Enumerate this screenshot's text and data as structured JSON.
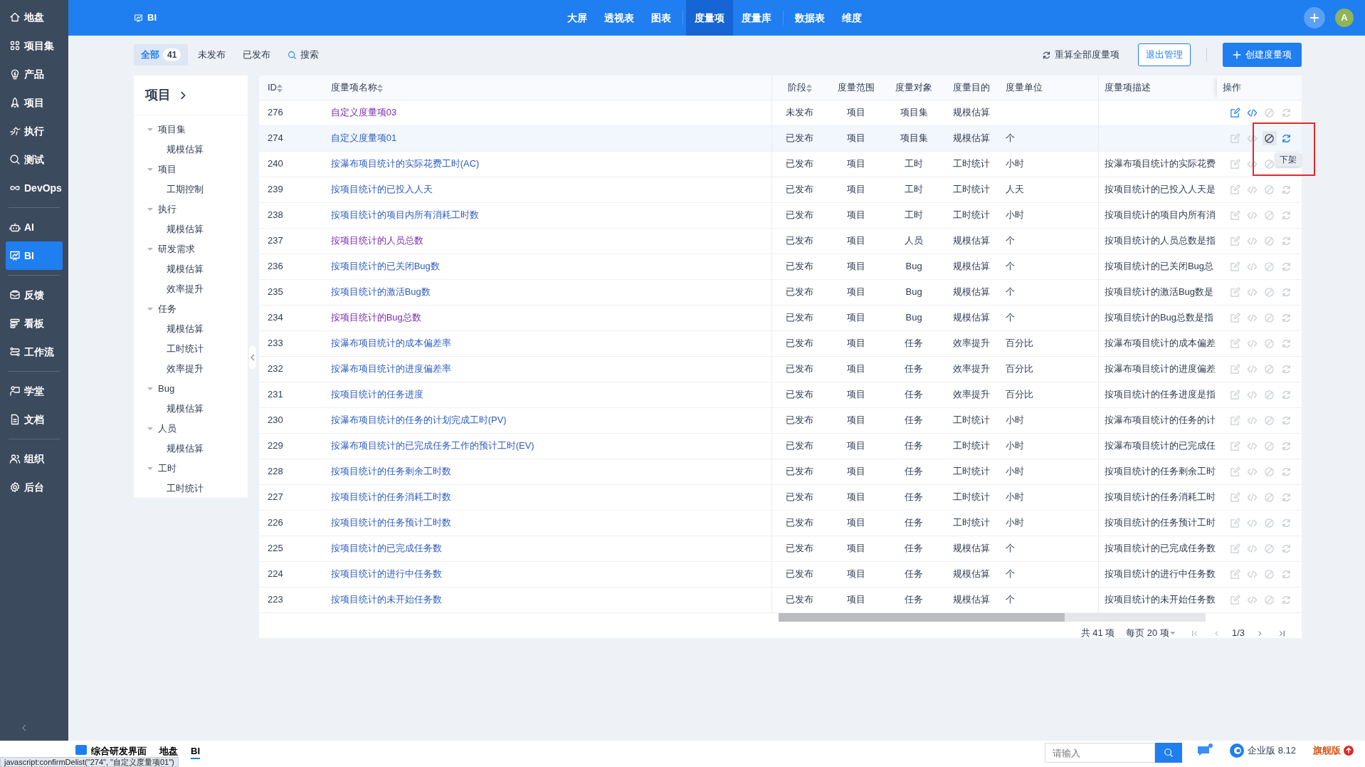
{
  "sidebar": {
    "items": [
      {
        "label": "地盘",
        "selected": false
      },
      {
        "label": "项目集",
        "selected": false
      },
      {
        "label": "产品",
        "selected": false
      },
      {
        "label": "项目",
        "selected": false
      },
      {
        "label": "执行",
        "selected": false
      },
      {
        "label": "测试",
        "selected": false
      },
      {
        "label": "DevOps",
        "selected": false
      },
      {
        "label": "AI",
        "selected": false
      },
      {
        "label": "BI",
        "selected": true
      },
      {
        "label": "反馈",
        "selected": false
      },
      {
        "label": "看板",
        "selected": false
      },
      {
        "label": "工作流",
        "selected": false
      },
      {
        "label": "学堂",
        "selected": false
      },
      {
        "label": "文档",
        "selected": false
      },
      {
        "label": "组织",
        "selected": false
      },
      {
        "label": "后台",
        "selected": false
      }
    ]
  },
  "header": {
    "app": "BI",
    "tabs": [
      {
        "label": "大屏",
        "selected": false
      },
      {
        "label": "透视表",
        "selected": false
      },
      {
        "label": "图表",
        "selected": false
      },
      {
        "label": "度量项",
        "selected": true
      },
      {
        "label": "度量库",
        "selected": false
      },
      {
        "label": "数据表",
        "selected": false
      },
      {
        "label": "维度",
        "selected": false
      }
    ],
    "avatar": "A"
  },
  "toolbar": {
    "filters": [
      {
        "label": "全部",
        "count": "41",
        "selected": true
      },
      {
        "label": "未发布",
        "selected": false
      },
      {
        "label": "已发布",
        "selected": false
      }
    ],
    "search": "搜索",
    "recalc": "重算全部度量项",
    "exit": "退出管理",
    "create": "创建度量项"
  },
  "tree": {
    "title": "项目",
    "items": [
      {
        "label": "项目集",
        "expanded": true,
        "children": [
          {
            "label": "规模估算"
          }
        ]
      },
      {
        "label": "项目",
        "expanded": true,
        "children": [
          {
            "label": "工期控制"
          }
        ]
      },
      {
        "label": "执行",
        "expanded": true,
        "children": [
          {
            "label": "规模估算"
          }
        ]
      },
      {
        "label": "研发需求",
        "expanded": true,
        "children": [
          {
            "label": "规模估算"
          },
          {
            "label": "效率提升"
          }
        ]
      },
      {
        "label": "任务",
        "expanded": true,
        "children": [
          {
            "label": "规模估算"
          },
          {
            "label": "工时统计"
          },
          {
            "label": "效率提升"
          }
        ]
      },
      {
        "label": "Bug",
        "expanded": true,
        "children": [
          {
            "label": "规模估算"
          }
        ]
      },
      {
        "label": "人员",
        "expanded": true,
        "children": [
          {
            "label": "规模估算"
          }
        ]
      },
      {
        "label": "工时",
        "expanded": true,
        "children": [
          {
            "label": "工时统计"
          }
        ]
      }
    ]
  },
  "table": {
    "columns": [
      "ID",
      "度量项名称",
      "阶段",
      "度量范围",
      "度量对象",
      "度量目的",
      "度量单位",
      "度量项描述",
      "操作"
    ],
    "rows": [
      {
        "id": "276",
        "name": "自定义度量项03",
        "visited": true,
        "stage": "未发布",
        "scope": "项目",
        "object": "项目集",
        "purpose": "规模估算",
        "unit": "",
        "desc": "",
        "hovered": false,
        "edit": true,
        "code": true,
        "delist": false,
        "recalc": false
      },
      {
        "id": "274",
        "name": "自定义度量项01",
        "visited": false,
        "stage": "已发布",
        "scope": "项目",
        "object": "项目集",
        "purpose": "规模估算",
        "unit": "个",
        "desc": "",
        "hovered": true,
        "edit": false,
        "code": false,
        "delist": true,
        "recalc": true
      },
      {
        "id": "240",
        "name": "按瀑布项目统计的实际花费工时(AC)",
        "visited": false,
        "stage": "已发布",
        "scope": "项目",
        "object": "工时",
        "purpose": "工时统计",
        "unit": "小时",
        "desc": "按瀑布项目统计的实际花费",
        "hovered": false,
        "edit": false,
        "code": false,
        "delist": false
      },
      {
        "id": "239",
        "name": "按项目统计的已投入人天",
        "visited": false,
        "stage": "已发布",
        "scope": "项目",
        "object": "工时",
        "purpose": "工时统计",
        "unit": "人天",
        "desc": "按项目统计的已投入人天是",
        "hovered": false,
        "edit": false,
        "code": false,
        "delist": false,
        "recalc": false
      },
      {
        "id": "238",
        "name": "按项目统计的项目内所有消耗工时数",
        "visited": false,
        "stage": "已发布",
        "scope": "项目",
        "object": "工时",
        "purpose": "工时统计",
        "unit": "小时",
        "desc": "按项目统计的项目内所有消",
        "hovered": false,
        "edit": false,
        "code": false,
        "delist": false,
        "recalc": false
      },
      {
        "id": "237",
        "name": "按项目统计的人员总数",
        "visited": true,
        "stage": "已发布",
        "scope": "项目",
        "object": "人员",
        "purpose": "规模估算",
        "unit": "个",
        "desc": "按项目统计的人员总数是指",
        "hovered": false,
        "edit": false,
        "code": false,
        "delist": false,
        "recalc": false
      },
      {
        "id": "236",
        "name": "按项目统计的已关闭Bug数",
        "visited": false,
        "stage": "已发布",
        "scope": "项目",
        "object": "Bug",
        "purpose": "规模估算",
        "unit": "个",
        "desc": "按项目统计的已关闭Bug总",
        "hovered": false,
        "edit": false,
        "code": false,
        "delist": false,
        "recalc": false
      },
      {
        "id": "235",
        "name": "按项目统计的激活Bug数",
        "visited": false,
        "stage": "已发布",
        "scope": "项目",
        "object": "Bug",
        "purpose": "规模估算",
        "unit": "个",
        "desc": "按项目统计的激活Bug数是",
        "hovered": false,
        "edit": false,
        "code": false,
        "delist": false,
        "recalc": false
      },
      {
        "id": "234",
        "name": "按项目统计的Bug总数",
        "visited": true,
        "stage": "已发布",
        "scope": "项目",
        "object": "Bug",
        "purpose": "规模估算",
        "unit": "个",
        "desc": "按项目统计的Bug总数是指",
        "hovered": false,
        "edit": false,
        "code": false,
        "delist": false,
        "recalc": false
      },
      {
        "id": "233",
        "name": "按瀑布项目统计的成本偏差率",
        "visited": false,
        "stage": "已发布",
        "scope": "项目",
        "object": "任务",
        "purpose": "效率提升",
        "unit": "百分比",
        "desc": "按瀑布项目统计的成本偏差",
        "hovered": false,
        "edit": false,
        "code": false,
        "delist": false,
        "recalc": false
      },
      {
        "id": "232",
        "name": "按瀑布项目统计的进度偏差率",
        "visited": false,
        "stage": "已发布",
        "scope": "项目",
        "object": "任务",
        "purpose": "效率提升",
        "unit": "百分比",
        "desc": "按瀑布项目统计的进度偏差",
        "hovered": false,
        "edit": false,
        "code": false,
        "delist": false,
        "recalc": false
      },
      {
        "id": "231",
        "name": "按项目统计的任务进度",
        "visited": false,
        "stage": "已发布",
        "scope": "项目",
        "object": "任务",
        "purpose": "效率提升",
        "unit": "百分比",
        "desc": "按项目统计的任务进度是指",
        "hovered": false,
        "edit": false,
        "code": false,
        "delist": false,
        "recalc": false
      },
      {
        "id": "230",
        "name": "按瀑布项目统计的任务的计划完成工时(PV)",
        "visited": false,
        "stage": "已发布",
        "scope": "项目",
        "object": "任务",
        "purpose": "工时统计",
        "unit": "小时",
        "desc": "按瀑布项目统计的任务的计",
        "hovered": false,
        "edit": false,
        "code": false,
        "delist": false,
        "recalc": false
      },
      {
        "id": "229",
        "name": "按瀑布项目统计的已完成任务工作的预计工时(EV)",
        "visited": false,
        "stage": "已发布",
        "scope": "项目",
        "object": "任务",
        "purpose": "工时统计",
        "unit": "小时",
        "desc": "按瀑布项目统计的已完成任",
        "hovered": false,
        "edit": false,
        "code": false,
        "delist": false,
        "recalc": false
      },
      {
        "id": "228",
        "name": "按项目统计的任务剩余工时数",
        "visited": false,
        "stage": "已发布",
        "scope": "项目",
        "object": "任务",
        "purpose": "工时统计",
        "unit": "小时",
        "desc": "按项目统计的任务剩余工时",
        "hovered": false,
        "edit": false,
        "code": false,
        "delist": false,
        "recalc": false
      },
      {
        "id": "227",
        "name": "按项目统计的任务消耗工时数",
        "visited": false,
        "stage": "已发布",
        "scope": "项目",
        "object": "任务",
        "purpose": "工时统计",
        "unit": "小时",
        "desc": "按项目统计的任务消耗工时",
        "hovered": false,
        "edit": false,
        "code": false,
        "delist": false,
        "recalc": false
      },
      {
        "id": "226",
        "name": "按项目统计的任务预计工时数",
        "visited": false,
        "stage": "已发布",
        "scope": "项目",
        "object": "任务",
        "purpose": "工时统计",
        "unit": "小时",
        "desc": "按项目统计的任务预计工时",
        "hovered": false,
        "edit": false,
        "code": false,
        "delist": false,
        "recalc": false
      },
      {
        "id": "225",
        "name": "按项目统计的已完成任务数",
        "visited": false,
        "stage": "已发布",
        "scope": "项目",
        "object": "任务",
        "purpose": "规模估算",
        "unit": "个",
        "desc": "按项目统计的已完成任务数",
        "hovered": false,
        "edit": false,
        "code": false,
        "delist": false,
        "recalc": false
      },
      {
        "id": "224",
        "name": "按项目统计的进行中任务数",
        "visited": false,
        "stage": "已发布",
        "scope": "项目",
        "object": "任务",
        "purpose": "规模估算",
        "unit": "个",
        "desc": "按项目统计的进行中任务数",
        "hovered": false,
        "edit": false,
        "code": false,
        "delist": false,
        "recalc": false
      },
      {
        "id": "223",
        "name": "按项目统计的未开始任务数",
        "visited": false,
        "stage": "已发布",
        "scope": "项目",
        "object": "任务",
        "purpose": "规模估算",
        "unit": "个",
        "desc": "按项目统计的未开始任务数",
        "hovered": false,
        "edit": false,
        "code": false,
        "delist": false,
        "recalc": false
      }
    ],
    "tooltip": "下架"
  },
  "pager": {
    "total": "共 41 项",
    "per_page": "每页 20 项",
    "page": "1/3"
  },
  "taskbar": {
    "apps": [
      {
        "label": "综合研发界面",
        "selected": false
      },
      {
        "label": "地盘",
        "selected": false
      },
      {
        "label": "BI",
        "selected": true
      }
    ],
    "search_placeholder": "请输入",
    "version": "企业版 8.12",
    "edition": "旗舰版"
  },
  "status_url": "javascript:confirmDelist(\"274\", \"自定义度量项01\")"
}
